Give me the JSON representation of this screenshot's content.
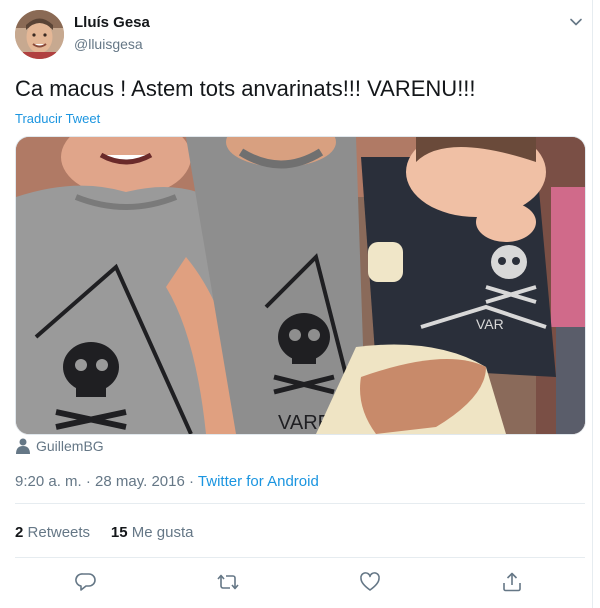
{
  "author": {
    "name": "Lluís Gesa",
    "handle": "@lluisgesa"
  },
  "tweet": {
    "text": "Ca macus ! Astem tots anvarinats!!! VARENU!!!",
    "translate_label": "Traducir Tweet",
    "tagged_user": "GuillemBG",
    "time": "9:20 a. m.",
    "date": "28 may. 2016",
    "separator": "·",
    "source": "Twitter for Android",
    "media_shirt_text": "VARENU"
  },
  "stats": {
    "retweets_count": "2",
    "retweets_label": "Retweets",
    "likes_count": "15",
    "likes_label": "Me gusta"
  },
  "icons": {
    "caret": "chevron-down-icon",
    "reply": "reply-icon",
    "retweet": "retweet-icon",
    "like": "heart-icon",
    "share": "share-icon",
    "tagged": "person-icon"
  },
  "colors": {
    "link": "#1b95e0",
    "secondary_text": "#657786",
    "primary_text": "#14171a",
    "divider": "#e6ecf0"
  }
}
